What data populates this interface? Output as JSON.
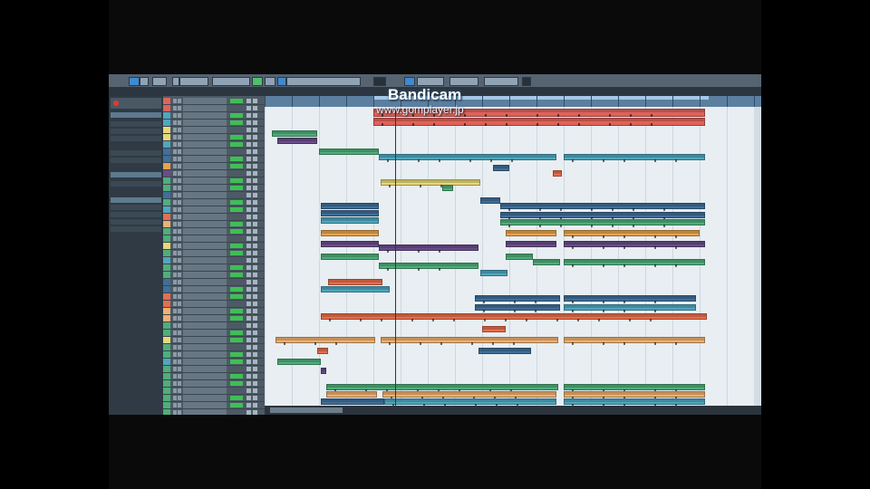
{
  "watermark": {
    "title": "Bandicam",
    "url": "www.gomplayer.jp"
  },
  "colors": {
    "red": "#e0625a",
    "teal": "#4fa7bf",
    "yellow": "#e8d878",
    "green": "#4fae7a",
    "blue": "#3f6f9a",
    "orange": "#e8a34a",
    "purple": "#6a4c8a",
    "salmon": "#e86e4c",
    "peach": "#f0b070"
  }
}
